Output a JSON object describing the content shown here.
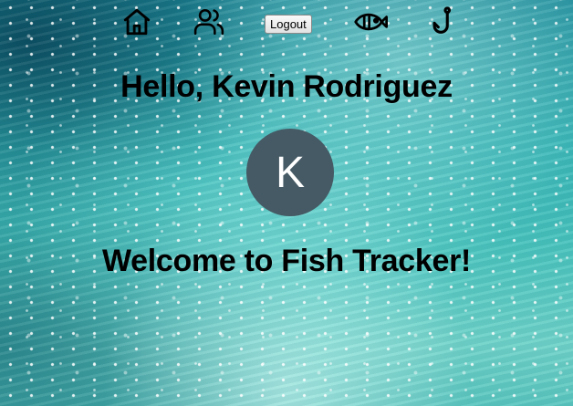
{
  "nav": {
    "icons": [
      "home-icon",
      "users-icon",
      "fish-icon",
      "fishing-hook-icon"
    ],
    "logout_label": "Logout"
  },
  "profile": {
    "greeting": "Hello, Kevin Rodriguez",
    "avatar_initial": "K",
    "avatar_color": "#455a64"
  },
  "main": {
    "welcome": "Welcome to Fish Tracker!"
  }
}
